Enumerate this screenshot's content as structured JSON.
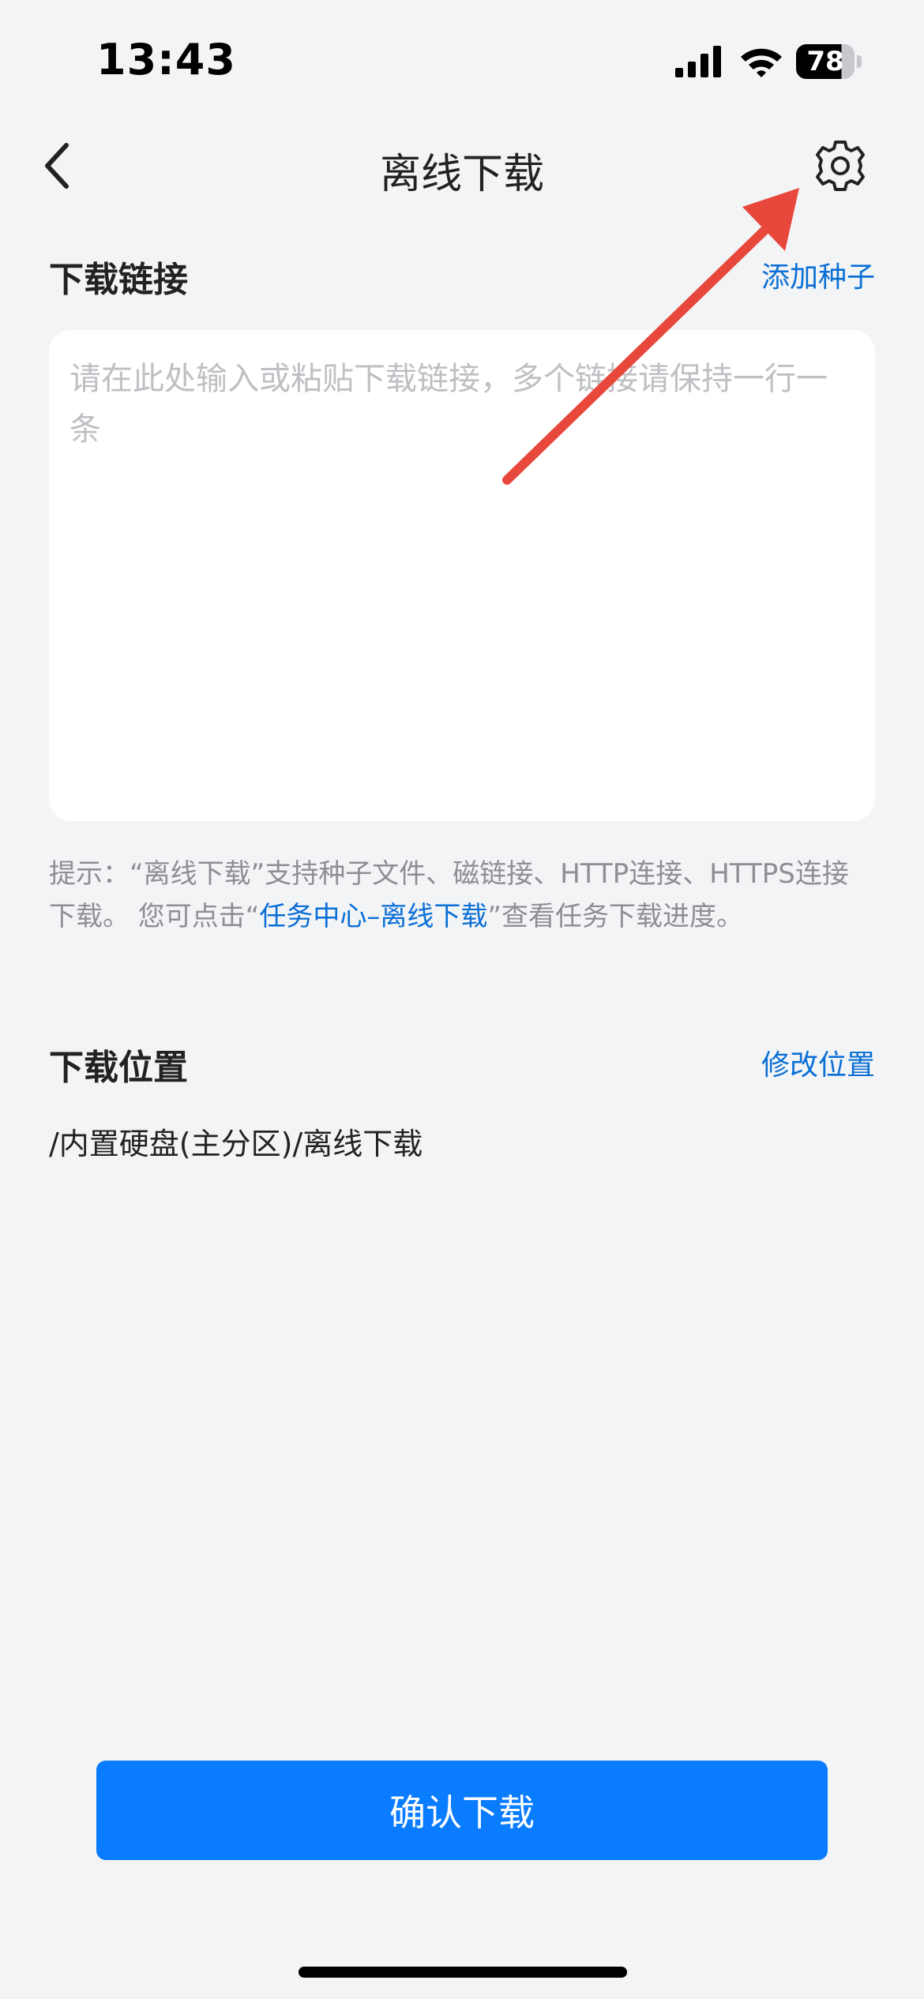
{
  "status_bar": {
    "time": "13:43",
    "battery_level": "78",
    "icons": [
      "signal-icon",
      "wifi-icon",
      "battery-icon"
    ]
  },
  "nav": {
    "back_icon": "chevron-left-icon",
    "title": "离线下载",
    "settings_icon": "gear-icon"
  },
  "download_link": {
    "section_title": "下载链接",
    "add_torrent_label": "添加种子",
    "input_value": "",
    "input_placeholder": "请在此处输入或粘贴下载链接，多个链接请保持一行一条"
  },
  "hint": {
    "prefix": "提示：“离线下载”支持种子文件、磁链接、HTTP连接、HTTPS连接下载。 您可点击“",
    "link_text": "任务中心–离线下载",
    "suffix": "”查看任务下载进度。"
  },
  "download_location": {
    "section_title": "下载位置",
    "modify_label": "修改位置",
    "path": "/内置硬盘(主分区)/离线下载"
  },
  "confirm_button_label": "确认下载",
  "colors": {
    "accent": "#0a7cff",
    "link": "#0a6fd6",
    "background": "#f3f4f6",
    "annotation_arrow": "#e8483b"
  }
}
